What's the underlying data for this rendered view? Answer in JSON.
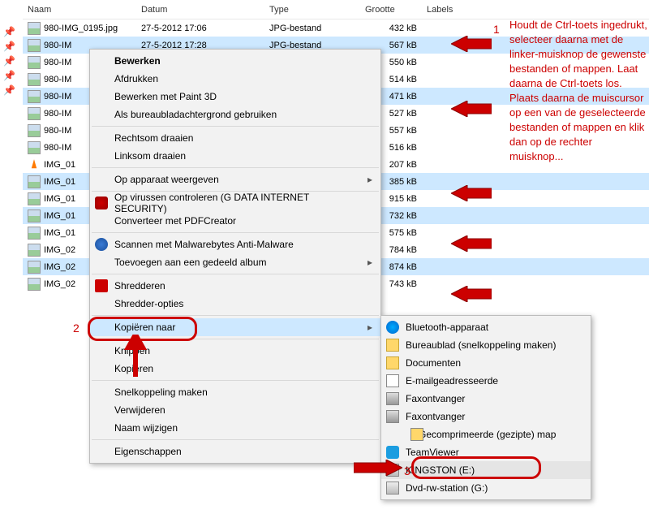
{
  "headers": {
    "name": "Naam",
    "date": "Datum",
    "type": "Type",
    "size": "Grootte",
    "labels": "Labels"
  },
  "files": [
    {
      "name": "980-IMG_0195.jpg",
      "date": "27-5-2012 17:06",
      "type": "JPG-bestand",
      "size": "432 kB",
      "sel": false,
      "icon": "img"
    },
    {
      "name": "980-IM",
      "date": "27-5-2012 17:28",
      "type": "JPG-bestand",
      "size": "567 kB",
      "sel": true,
      "icon": "img"
    },
    {
      "name": "980-IM",
      "date": "",
      "type": "",
      "size": "550 kB",
      "sel": false,
      "icon": "img"
    },
    {
      "name": "980-IM",
      "date": "",
      "type": "",
      "size": "514 kB",
      "sel": false,
      "icon": "img"
    },
    {
      "name": "980-IM",
      "date": "",
      "type": "",
      "size": "471 kB",
      "sel": true,
      "icon": "img"
    },
    {
      "name": "980-IM",
      "date": "",
      "type": "",
      "size": "527 kB",
      "sel": false,
      "icon": "img"
    },
    {
      "name": "980-IM",
      "date": "",
      "type": "",
      "size": "557 kB",
      "sel": false,
      "icon": "img"
    },
    {
      "name": "980-IM",
      "date": "",
      "type": "",
      "size": "516 kB",
      "sel": false,
      "icon": "img"
    },
    {
      "name": "IMG_01",
      "date": "",
      "type": "",
      "size": "207 kB",
      "sel": false,
      "icon": "vlc"
    },
    {
      "name": "IMG_01",
      "date": "",
      "type": "",
      "size": "385 kB",
      "sel": true,
      "icon": "img"
    },
    {
      "name": "IMG_01",
      "date": "",
      "type": "",
      "size": "915 kB",
      "sel": false,
      "icon": "img"
    },
    {
      "name": "IMG_01",
      "date": "",
      "type": "",
      "size": "732 kB",
      "sel": true,
      "icon": "img"
    },
    {
      "name": "IMG_01",
      "date": "",
      "type": "",
      "size": "575 kB",
      "sel": false,
      "icon": "img"
    },
    {
      "name": "IMG_02",
      "date": "",
      "type": "",
      "size": "784 kB",
      "sel": false,
      "icon": "img"
    },
    {
      "name": "IMG_02",
      "date": "",
      "type": "",
      "size": "874 kB",
      "sel": true,
      "icon": "img"
    },
    {
      "name": "IMG_02",
      "date": "",
      "type": "",
      "size": "743 kB",
      "sel": false,
      "icon": "img"
    }
  ],
  "ctx": {
    "items": [
      {
        "label": "Bewerken",
        "bold": true
      },
      {
        "label": "Afdrukken"
      },
      {
        "label": "Bewerken met Paint 3D"
      },
      {
        "label": "Als bureaubladachtergrond gebruiken"
      },
      {
        "sep": true
      },
      {
        "label": "Rechtsom draaien"
      },
      {
        "label": "Linksom draaien"
      },
      {
        "sep": true
      },
      {
        "label": "Op apparaat weergeven",
        "sub": true
      },
      {
        "sep": true
      },
      {
        "label": "Op virussen controleren (G DATA INTERNET SECURITY)",
        "icon": "shield"
      },
      {
        "label": "Converteer met PDFCreator"
      },
      {
        "sep": true
      },
      {
        "label": "Scannen met Malwarebytes Anti-Malware",
        "icon": "blue"
      },
      {
        "label": "Toevoegen aan een gedeeld album",
        "sub": true
      },
      {
        "sep": true
      },
      {
        "label": "Shredderen",
        "icon": "red"
      },
      {
        "label": "Shredder-opties"
      },
      {
        "sep": true
      },
      {
        "label": "Kopiëren naar",
        "sub": true,
        "hov": true
      },
      {
        "sep": true
      },
      {
        "label": "Knippen"
      },
      {
        "label": "Kopiëren"
      },
      {
        "sep": true
      },
      {
        "label": "Snelkoppeling maken"
      },
      {
        "label": "Verwijderen"
      },
      {
        "label": "Naam wijzigen"
      },
      {
        "sep": true
      },
      {
        "label": "Eigenschappen"
      }
    ]
  },
  "sub": {
    "items": [
      {
        "label": "Bluetooth-apparaat",
        "icon": "bt"
      },
      {
        "label": "Bureaublad (snelkoppeling maken)",
        "icon": "fold"
      },
      {
        "label": "Documenten",
        "icon": "fold"
      },
      {
        "label": "E-mailgeadresseerde",
        "icon": "mail"
      },
      {
        "label": "Faxontvanger",
        "icon": "fax"
      },
      {
        "label": "Faxontvanger",
        "icon": "fax"
      },
      {
        "label": "Gecomprimeerde (gezipte) map",
        "icon": "zip"
      },
      {
        "label": "TeamViewer",
        "icon": "tv"
      },
      {
        "label": "KINGSTON (E:)",
        "icon": "disk",
        "hov": true
      },
      {
        "label": "Dvd-rw-station (G:)",
        "icon": "disk"
      }
    ]
  },
  "annot": {
    "text": "Houdt de Ctrl-toets ingedrukt, selecteer daarna met de linker-muisknop de gewenste bestanden of mappen. Laat daarna de Ctrl-toets los.\nPlaats daarna de muiscursor op een van de geselecteerde bestanden of mappen en klik dan op de rechter muisknop..."
  },
  "steps": {
    "s1": "1",
    "s2": "2",
    "s3": "3"
  }
}
